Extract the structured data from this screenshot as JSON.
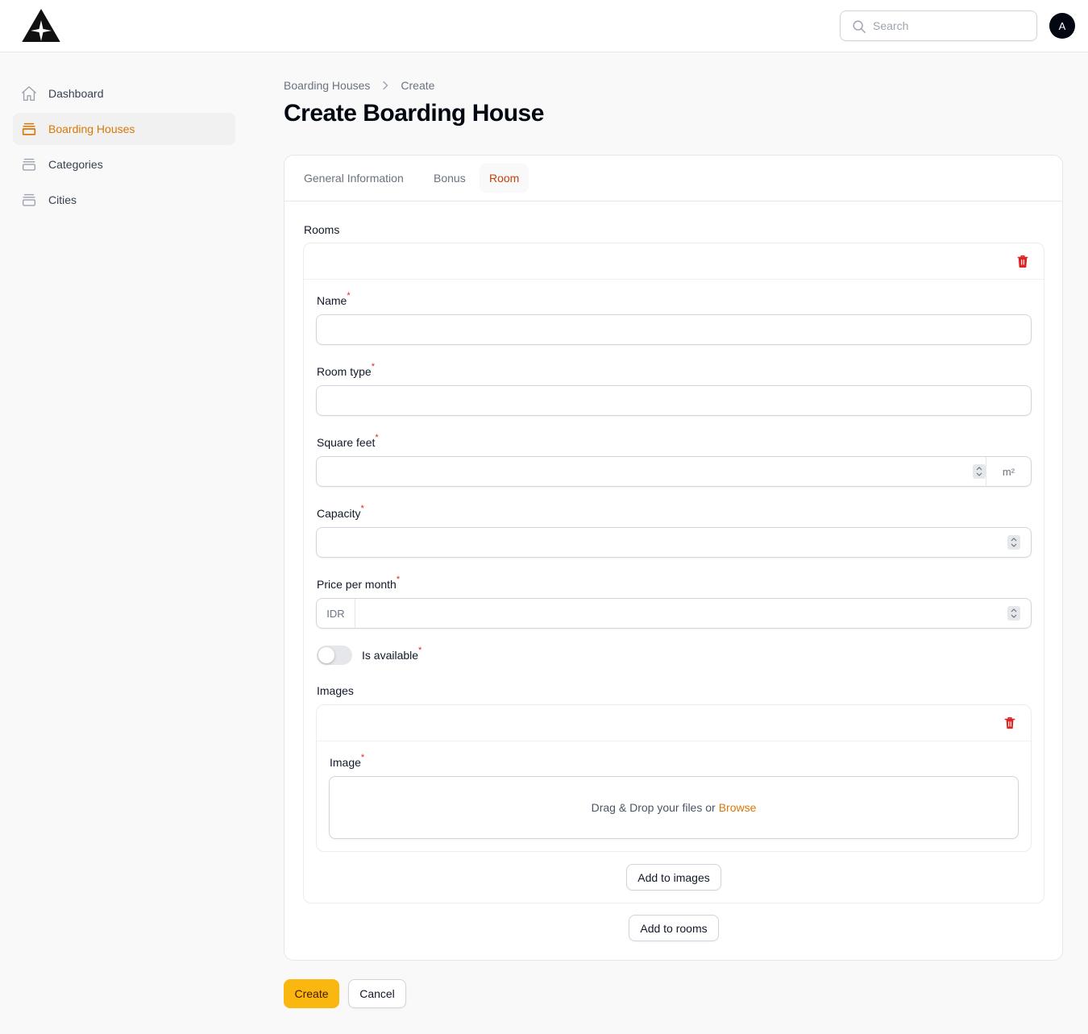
{
  "header": {
    "search_placeholder": "Search",
    "avatar_initial": "A"
  },
  "sidebar": {
    "items": [
      {
        "label": "Dashboard",
        "icon": "home-icon",
        "active": false
      },
      {
        "label": "Boarding Houses",
        "icon": "stack-icon",
        "active": true
      },
      {
        "label": "Categories",
        "icon": "stack-icon",
        "active": false
      },
      {
        "label": "Cities",
        "icon": "stack-icon",
        "active": false
      }
    ]
  },
  "breadcrumb": [
    "Boarding Houses",
    "Create"
  ],
  "page_title": "Create Boarding House",
  "tabs": [
    {
      "label": "General Information",
      "active": false
    },
    {
      "label": "Bonus",
      "active": false
    },
    {
      "label": "Room",
      "active": true
    }
  ],
  "rooms_section": {
    "label": "Rooms",
    "fields": {
      "name": {
        "label": "Name",
        "value": ""
      },
      "room_type": {
        "label": "Room type",
        "value": ""
      },
      "square_feet": {
        "label": "Square feet",
        "value": "",
        "suffix": "m²"
      },
      "capacity": {
        "label": "Capacity",
        "value": ""
      },
      "price_per_month": {
        "label": "Price per month",
        "value": "",
        "prefix": "IDR"
      },
      "is_available": {
        "label": "Is available",
        "checked": false
      }
    },
    "images": {
      "label": "Images",
      "image_label": "Image",
      "dropzone_text": "Drag & Drop your files or",
      "browse_label": "Browse",
      "add_button": "Add to images"
    },
    "add_button": "Add to rooms"
  },
  "form_actions": {
    "create": "Create",
    "cancel": "Cancel"
  },
  "colors": {
    "accent": "#d97706",
    "primary_button": "#f9b70f",
    "danger": "#dc2626"
  }
}
